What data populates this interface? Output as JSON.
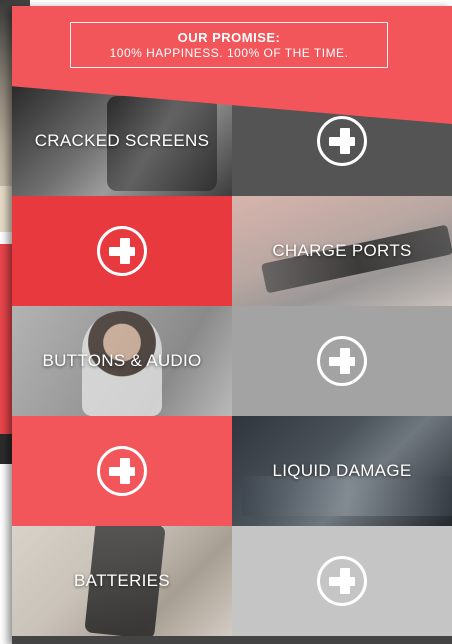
{
  "promo": {
    "title": "OUR PROMISE:",
    "text": "100% HAPPINESS. 100% OF THE TIME."
  },
  "services": [
    {
      "label": "CRACKED SCREENS"
    },
    {
      "label": "CHARGE PORTS"
    },
    {
      "label": "BUTTONS & AUDIO"
    },
    {
      "label": "LIQUID DAMAGE"
    },
    {
      "label": "BATTERIES"
    }
  ],
  "icons": {
    "expand": "plus-circle-icon"
  },
  "colors": {
    "accent_red": "#f2555a",
    "accent_red_dark": "#e8393f",
    "gray_dark": "#545454",
    "gray_mid": "#a3a3a3",
    "gray_light": "#c5c5c5"
  }
}
